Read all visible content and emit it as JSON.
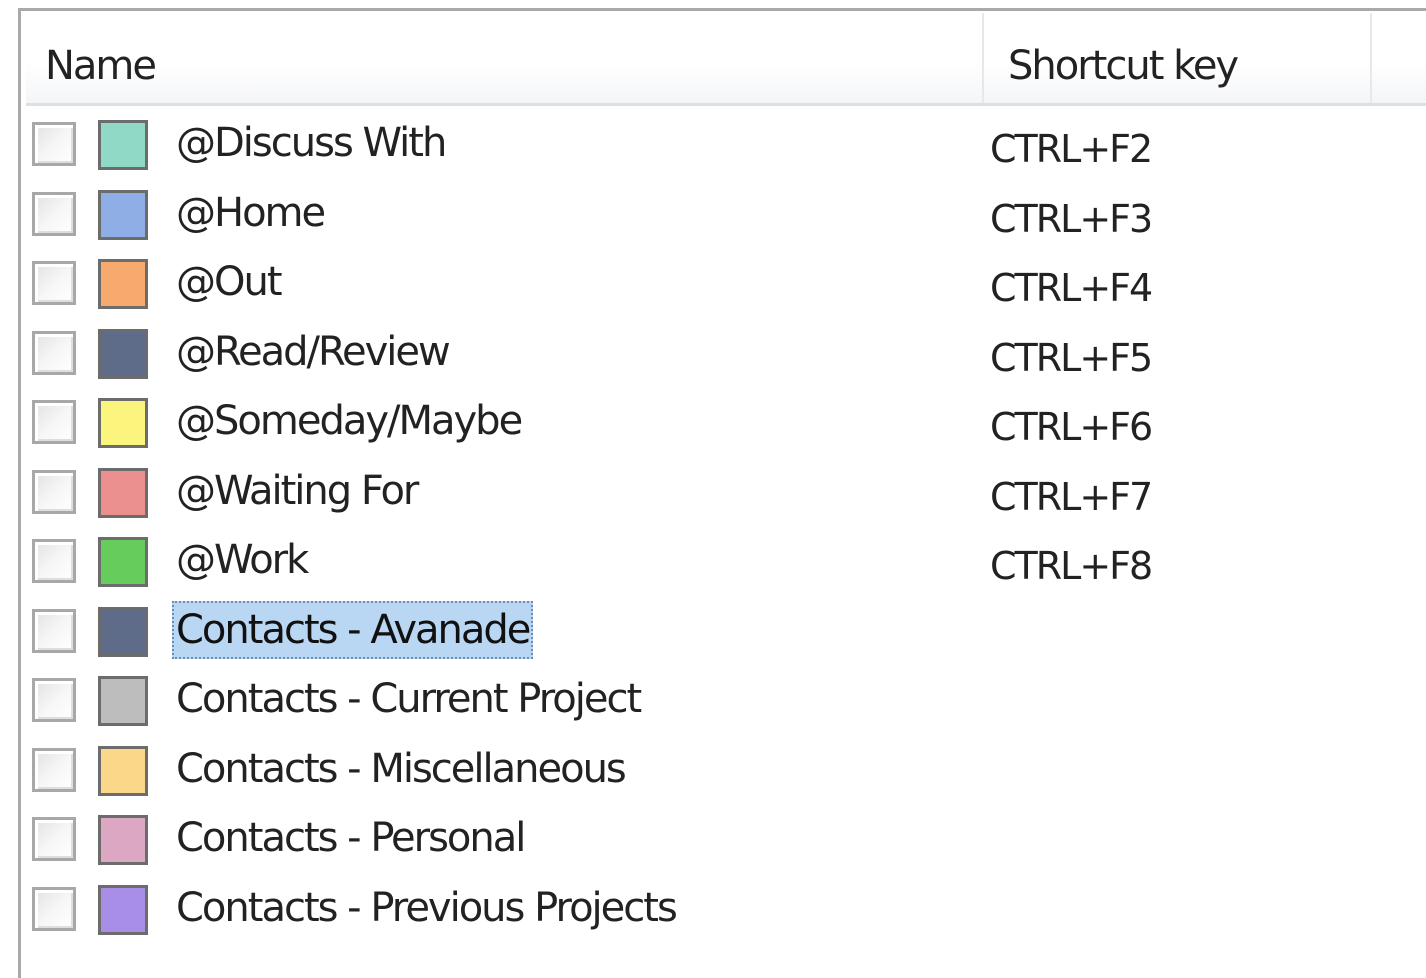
{
  "columns": {
    "name": "Name",
    "shortcut_key": "Shortcut key"
  },
  "categories": [
    {
      "name": "@Discuss With",
      "color": "#8fd9c6",
      "shortcut": "CTRL+F2",
      "checked": false,
      "selected": false
    },
    {
      "name": "@Home",
      "color": "#8faee6",
      "shortcut": "CTRL+F3",
      "checked": false,
      "selected": false
    },
    {
      "name": "@Out",
      "color": "#f7a96e",
      "shortcut": "CTRL+F4",
      "checked": false,
      "selected": false
    },
    {
      "name": "@Read/Review",
      "color": "#5e6c8a",
      "shortcut": "CTRL+F5",
      "checked": false,
      "selected": false
    },
    {
      "name": "@Someday/Maybe",
      "color": "#fbf47d",
      "shortcut": "CTRL+F6",
      "checked": false,
      "selected": false
    },
    {
      "name": "@Waiting For",
      "color": "#ec8f8f",
      "shortcut": "CTRL+F7",
      "checked": false,
      "selected": false
    },
    {
      "name": "@Work",
      "color": "#66cc5c",
      "shortcut": "CTRL+F8",
      "checked": false,
      "selected": false
    },
    {
      "name": "Contacts - Avanade",
      "color": "#5e6c8a",
      "shortcut": "",
      "checked": false,
      "selected": true
    },
    {
      "name": "Contacts - Current Project",
      "color": "#bdbdbd",
      "shortcut": "",
      "checked": false,
      "selected": false
    },
    {
      "name": "Contacts - Miscellaneous",
      "color": "#fbd889",
      "shortcut": "",
      "checked": false,
      "selected": false
    },
    {
      "name": "Contacts - Personal",
      "color": "#dca7c2",
      "shortcut": "",
      "checked": false,
      "selected": false
    },
    {
      "name": "Contacts - Previous Projects",
      "color": "#a88ee6",
      "shortcut": "",
      "checked": false,
      "selected": false
    }
  ]
}
